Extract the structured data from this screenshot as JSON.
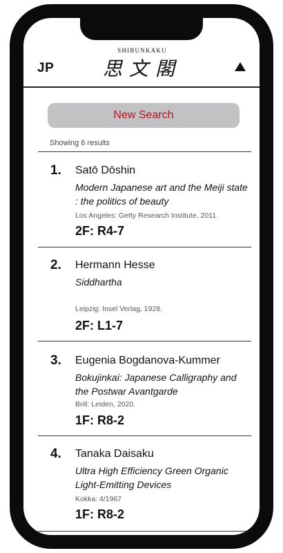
{
  "header": {
    "lang_toggle": "JP",
    "logo_small": "SHIBUNKAKU",
    "logo_kanji": "思文閣",
    "menu_icon": "triangle-up-icon"
  },
  "search": {
    "new_search_label": "New Search",
    "results_summary": "Showing 6 results"
  },
  "results": [
    {
      "number": "1.",
      "author": "Satō Dōshin",
      "title": "Modern Japanese art and the Meiji state : the politics of beauty",
      "publisher": "Los Angeles: Getty Research Institute, 2011.",
      "location": "2F: R4-7"
    },
    {
      "number": "2.",
      "author": "Hermann Hesse",
      "title": "Siddhartha",
      "publisher": "Leipzig: Insel Verlag, 1928.",
      "location": "2F: L1-7"
    },
    {
      "number": "3.",
      "author": "Eugenia Bogdanova-Kummer",
      "title": "Bokujinkai: Japanese Calligraphy and the Postwar Avantgarde",
      "publisher": "Brill: Leiden, 2020.",
      "location": "1F: R8-2"
    },
    {
      "number": "4.",
      "author": "Tanaka Daisaku",
      "title": "Ultra High Efficiency Green Organic Light-Emitting Devices",
      "publisher": "Kokka: 4/1967",
      "location": "1F: R8-2"
    }
  ],
  "colors": {
    "accent_red": "#b0141d",
    "button_gray": "#c2c2c4",
    "frame": "#0b0b0b"
  }
}
